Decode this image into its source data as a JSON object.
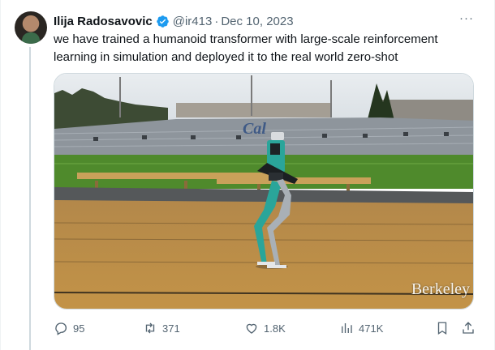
{
  "author": {
    "name": "Ilija Radosavovic",
    "handle": "@ir413",
    "separator": "·",
    "date": "Dec 10, 2023",
    "verified_icon": "verified-badge-icon"
  },
  "more_label": "···",
  "tweet": {
    "text": "we have trained a humanoid transformer with large-scale reinforcement\nlearning in simulation and deployed it to the real world zero-shot"
  },
  "media": {
    "stadium_sign": "Cal",
    "watermark": "Berkeley"
  },
  "actions": {
    "replies": "95",
    "retweets": "371",
    "likes": "1.8K",
    "views": "471K"
  },
  "colors": {
    "accent": "#1d9bf0",
    "muted": "#536471",
    "track": "#b58a3e",
    "grass": "#4f8a2c"
  }
}
